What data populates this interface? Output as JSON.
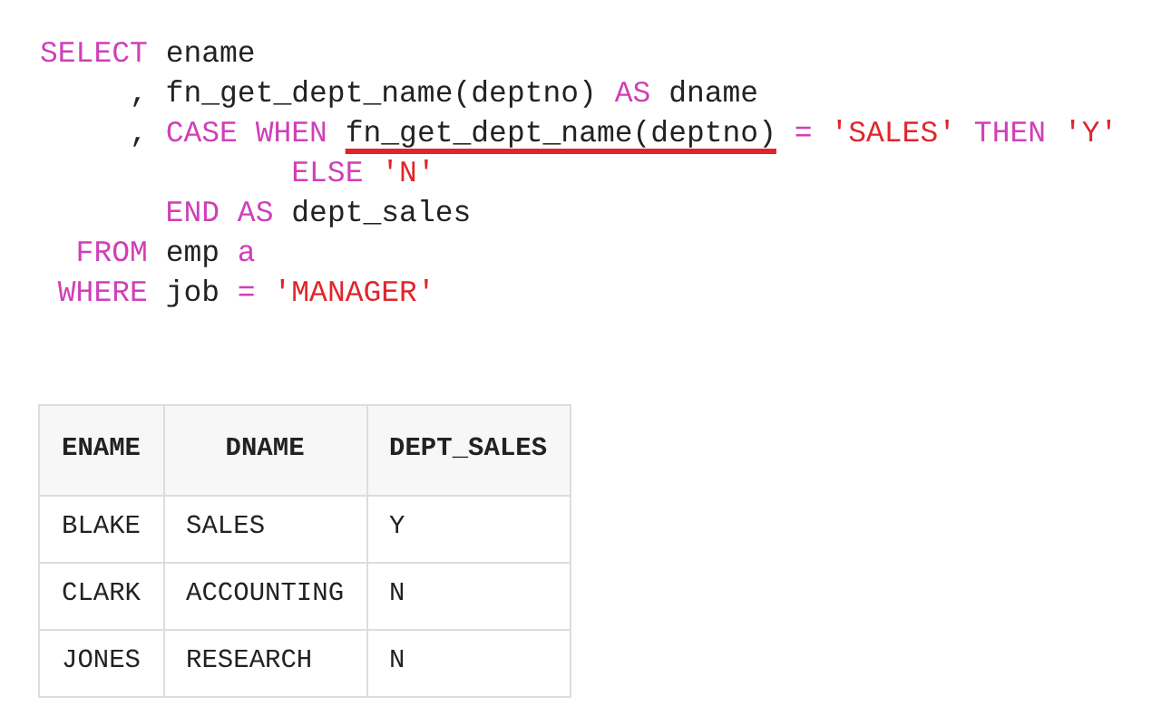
{
  "code": [
    [
      {
        "kind": "keyword",
        "text": "SELECT"
      },
      {
        "kind": "plain",
        "text": " ename"
      }
    ],
    [
      {
        "kind": "plain",
        "text": "     , fn_get_dept_name(deptno) "
      },
      {
        "kind": "keyword",
        "text": "AS"
      },
      {
        "kind": "plain",
        "text": " dname"
      }
    ],
    [
      {
        "kind": "plain",
        "text": "     , "
      },
      {
        "kind": "keyword",
        "text": "CASE WHEN "
      },
      {
        "kind": "plain",
        "text": "fn_get_dept_name(deptno)",
        "underlined": true
      },
      {
        "kind": "keyword",
        "text": " ="
      },
      {
        "kind": "string",
        "text": " 'SALES'"
      },
      {
        "kind": "keyword",
        "text": " THEN"
      },
      {
        "kind": "string",
        "text": " 'Y'"
      }
    ],
    [
      {
        "kind": "keyword",
        "text": "              ELSE"
      },
      {
        "kind": "string",
        "text": " 'N'"
      }
    ],
    [
      {
        "kind": "keyword",
        "text": "       END AS"
      },
      {
        "kind": "plain",
        "text": " dept_sales"
      }
    ],
    [
      {
        "kind": "keyword",
        "text": "  FROM"
      },
      {
        "kind": "plain",
        "text": " emp"
      },
      {
        "kind": "keyword",
        "text": " a"
      }
    ],
    [
      {
        "kind": "keyword",
        "text": " WHERE"
      },
      {
        "kind": "plain",
        "text": " job"
      },
      {
        "kind": "keyword",
        "text": " ="
      },
      {
        "kind": "string",
        "text": " 'MANAGER'"
      }
    ]
  ],
  "table": {
    "columns": [
      "ENAME",
      "DNAME",
      "DEPT_SALES"
    ],
    "rows": [
      [
        "BLAKE",
        "SALES",
        "Y"
      ],
      [
        "CLARK",
        "ACCOUNTING",
        "N"
      ],
      [
        "JONES",
        "RESEARCH",
        "N"
      ]
    ]
  }
}
